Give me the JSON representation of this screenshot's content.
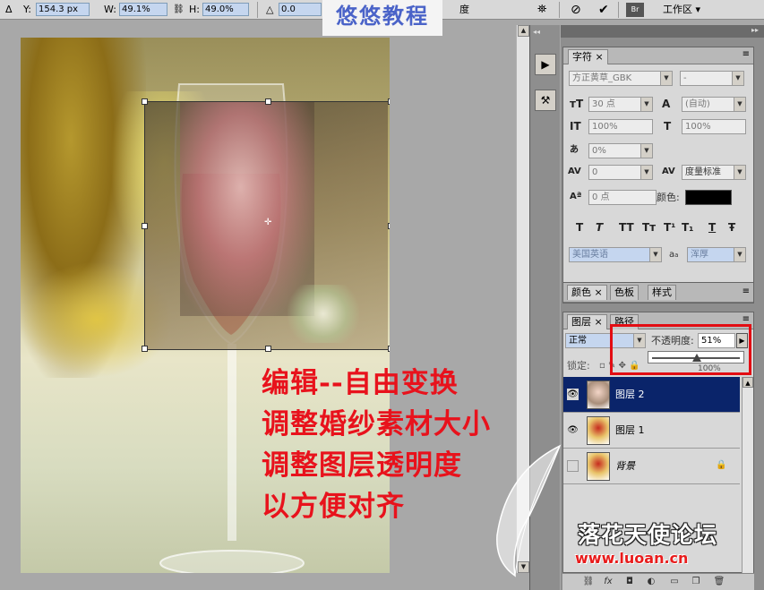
{
  "options_bar": {
    "y_label": "Y:",
    "y_value": "154.3 px",
    "w_label": "W:",
    "w_value": "49.1%",
    "h_label": "H:",
    "h_value": "49.0%",
    "angle_value": "0.0",
    "angle_unit": "度",
    "workspace_label": "工作区",
    "cancel_glyph": "⊘",
    "commit_glyph": "✔",
    "delta_glyph": "Δ",
    "angle_glyph": "△",
    "link_glyph": "⛓"
  },
  "top_watermark": "悠悠教程",
  "canvas_caption": [
    "编辑--自由变换",
    "调整婚纱素材大小",
    "调整图层透明度",
    "以方便对齐"
  ],
  "character_panel": {
    "tab_label": "字符",
    "font_family": "方正黄草_GBK",
    "font_style": "-",
    "font_size": "30 点",
    "leading": "(自动)",
    "vertical_scale": "100%",
    "horizontal_scale": "100%",
    "tracking_pct": "0%",
    "kerning": "0",
    "kerning_mode": "度量标准",
    "baseline_shift": "0 点",
    "color_label": "颜色:",
    "style_buttons": [
      "T",
      "T",
      "TT",
      "Tт",
      "T¹",
      "T₁",
      "T",
      "Ŧ"
    ],
    "language": "美国英语",
    "aa_label": "a",
    "antialias": "浑厚",
    "text_color": "#000000"
  },
  "color_panel": {
    "tabs": [
      "颜色",
      "色板",
      "样式"
    ]
  },
  "layers_panel": {
    "tabs": [
      "图层",
      "路径"
    ],
    "blend_mode": "正常",
    "opacity_label": "不透明度:",
    "opacity_value": "51%",
    "opacity_fraction": 0.51,
    "lock_label": "锁定:",
    "fill_value": "100%",
    "layers": [
      {
        "name": "图层 2",
        "visible": true,
        "selected": true
      },
      {
        "name": "图层 1",
        "visible": true,
        "selected": false
      },
      {
        "name": "背景",
        "visible": false,
        "selected": false,
        "locked": true
      }
    ]
  },
  "bottom_watermark": {
    "title": "落花天使论坛",
    "url": "www.luoan.cn"
  },
  "colors": {
    "highlight_red": "#e30d13",
    "selection_blue": "#0a246a",
    "input_blue": "#c5d6ef"
  }
}
